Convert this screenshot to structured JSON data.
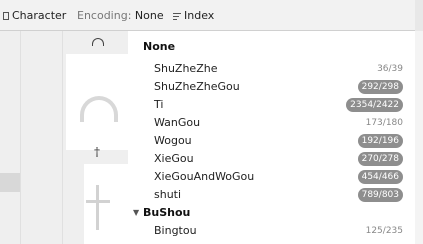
{
  "toolbar": {
    "character_label": "Character",
    "encoding_label": "Encoding:",
    "encoding_value": "None",
    "index_label": "Index"
  },
  "icons": {
    "character": "character-icon",
    "index": "index-list-icon",
    "collapse": "caret-down-icon"
  },
  "preview_glyphs": [
    "†"
  ],
  "groups": [
    {
      "name": "None",
      "items": [
        {
          "name": "ShuZheZhe",
          "count": "36/39",
          "highlight": false
        },
        {
          "name": "ShuZheZheGou",
          "count": "292/298",
          "highlight": true
        },
        {
          "name": "Ti",
          "count": "2354/2422",
          "highlight": true
        },
        {
          "name": "WanGou",
          "count": "173/180",
          "highlight": false
        },
        {
          "name": "Wogou",
          "count": "192/196",
          "highlight": true
        },
        {
          "name": "XieGou",
          "count": "270/278",
          "highlight": true
        },
        {
          "name": "XieGouAndWoGou",
          "count": "454/466",
          "highlight": true
        },
        {
          "name": "shuti",
          "count": "789/803",
          "highlight": true
        }
      ]
    },
    {
      "name": "BuShou",
      "items": [
        {
          "name": "Bingtou",
          "count": "125/235",
          "highlight": false
        }
      ]
    }
  ],
  "colors": {
    "pill": "#8e8e8e",
    "toolbar_bg": "#f2f2f2",
    "preview_bg": "#efefef"
  }
}
